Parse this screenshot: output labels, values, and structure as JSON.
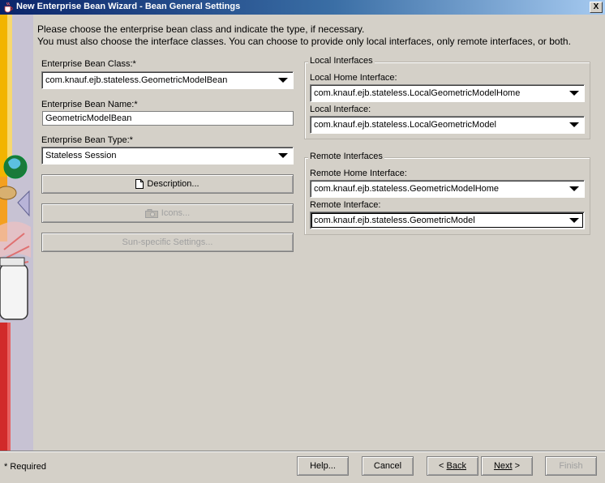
{
  "window": {
    "title": "New Enterprise Bean Wizard - Bean General Settings",
    "close_label": "X"
  },
  "intro": {
    "line1": "Please choose the enterprise bean class and indicate the type, if necessary.",
    "line2": "You must also choose the interface classes.  You can choose to provide only local interfaces, only remote interfaces, or both."
  },
  "left": {
    "bean_class_label": "Enterprise Bean Class:*",
    "bean_class_value": "com.knauf.ejb.stateless.GeometricModelBean",
    "bean_name_label": "Enterprise Bean Name:*",
    "bean_name_value": "GeometricModelBean",
    "bean_type_label": "Enterprise Bean Type:*",
    "bean_type_value": "Stateless Session",
    "description_button": "Description...",
    "icons_button": "Icons...",
    "sun_settings_button": "Sun-specific Settings..."
  },
  "local": {
    "group_label": "Local Interfaces",
    "home_label": "Local Home Interface:",
    "home_value": "com.knauf.ejb.stateless.LocalGeometricModelHome",
    "iface_label": "Local Interface:",
    "iface_value": "com.knauf.ejb.stateless.LocalGeometricModel"
  },
  "remote": {
    "group_label": "Remote Interfaces",
    "home_label": "Remote Home Interface:",
    "home_value": "com.knauf.ejb.stateless.GeometricModelHome",
    "iface_label": "Remote Interface:",
    "iface_value": "com.knauf.ejb.stateless.GeometricModel"
  },
  "footer": {
    "required_note": "* Required",
    "help_button": "Help...",
    "cancel_button": "Cancel",
    "back_prefix": "< ",
    "back_label": "Back",
    "next_label": "Next",
    "next_suffix": " >",
    "finish_button": "Finish"
  },
  "colors": {
    "title_bar": "#0a246a",
    "window_bg": "#d4d0c8",
    "disabled_text": "#a0a0a0"
  }
}
